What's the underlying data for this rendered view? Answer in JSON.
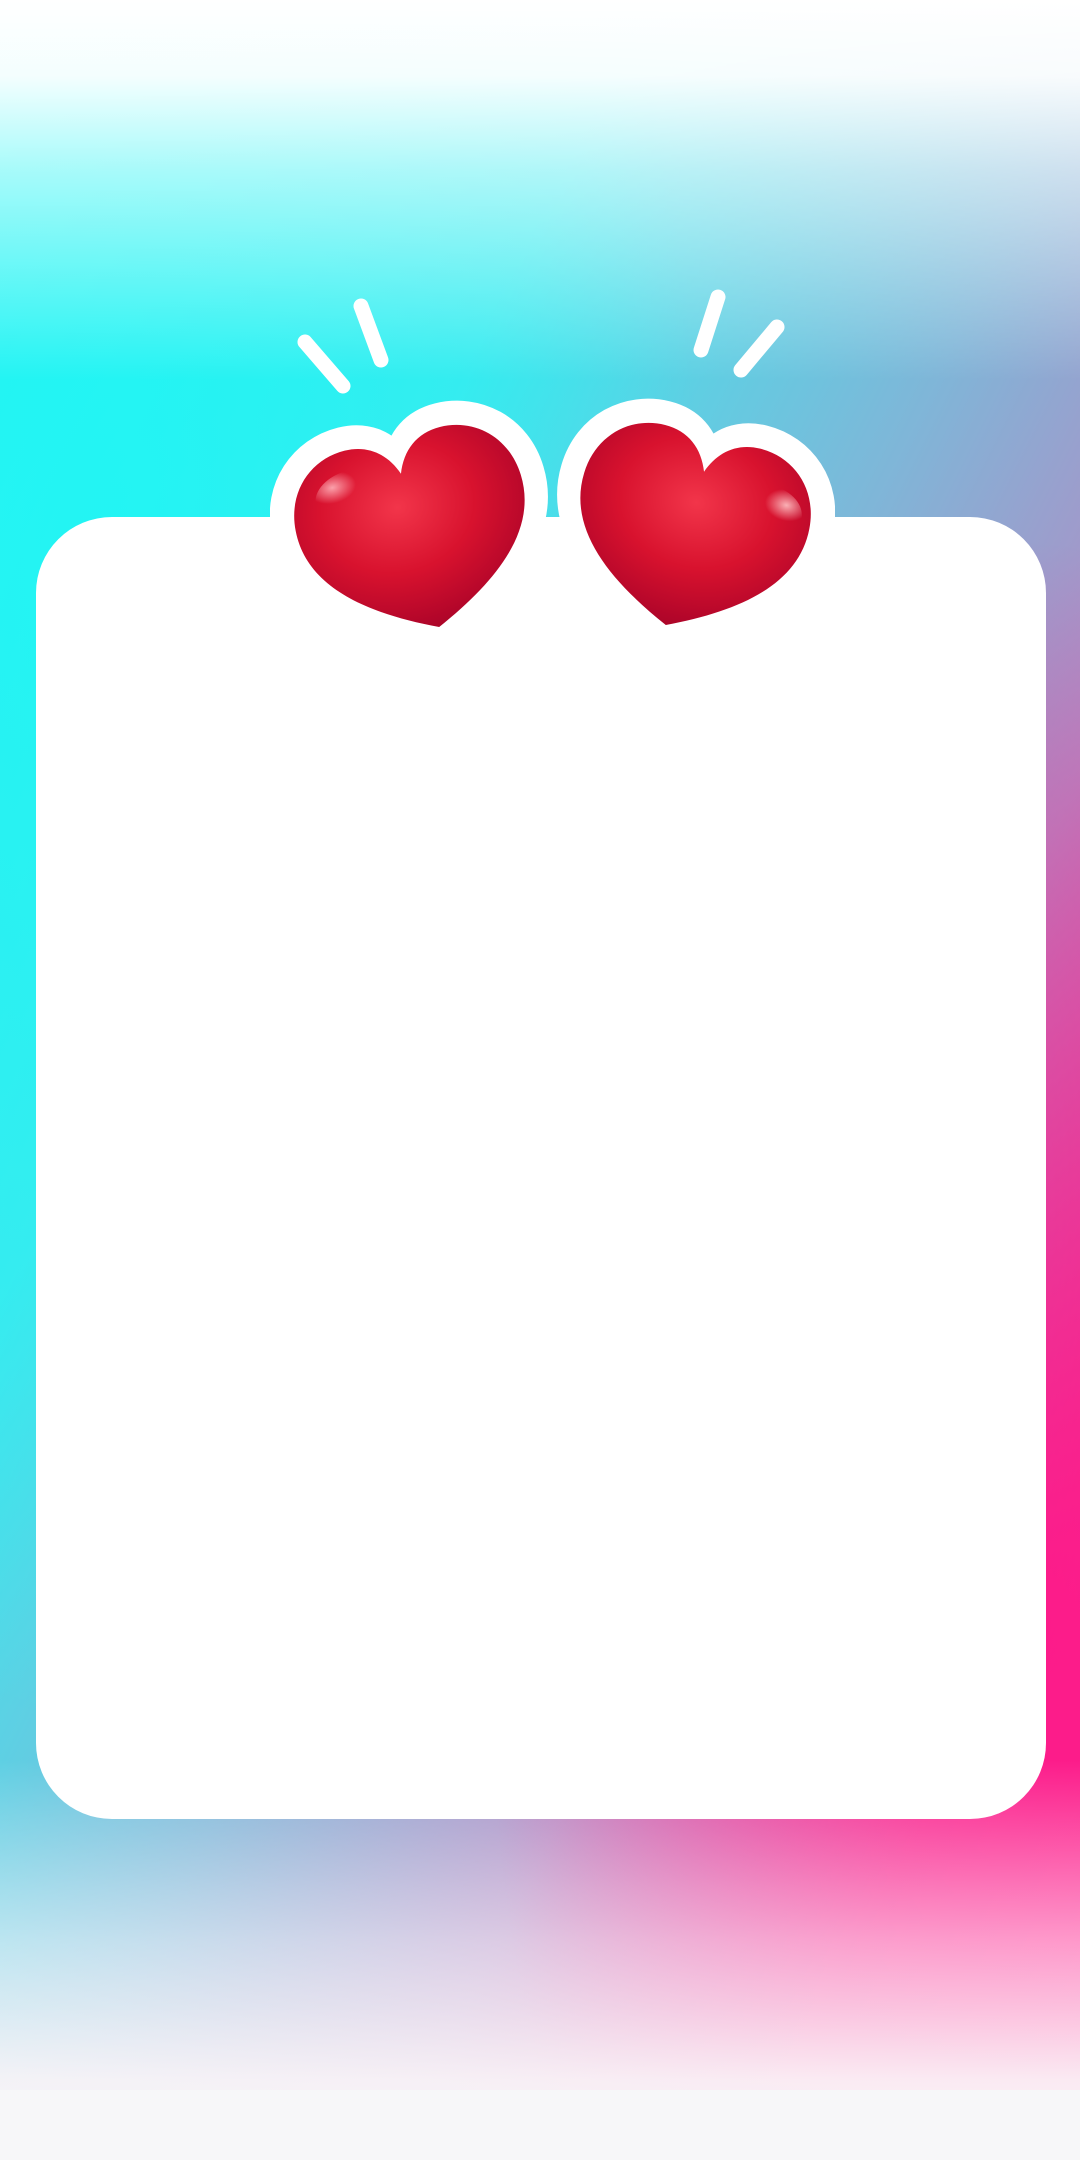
{
  "frame": {
    "colors": {
      "gradient_cyan": "#22f2f2",
      "gradient_blue": "#6bb5da",
      "gradient_purple": "#8a7ac0",
      "gradient_pink": "#f51f8c",
      "gradient_magenta": "#ff1a86",
      "card_background": "#ffffff",
      "heart_red": "#d3102c",
      "heart_outline": "#ffffff"
    },
    "decorations": [
      {
        "icon": "heart-icon",
        "side": "left"
      },
      {
        "icon": "heart-icon",
        "side": "right"
      },
      {
        "icon": "sparkle-lines-icon",
        "side": "left"
      },
      {
        "icon": "sparkle-lines-icon",
        "side": "right"
      }
    ]
  }
}
